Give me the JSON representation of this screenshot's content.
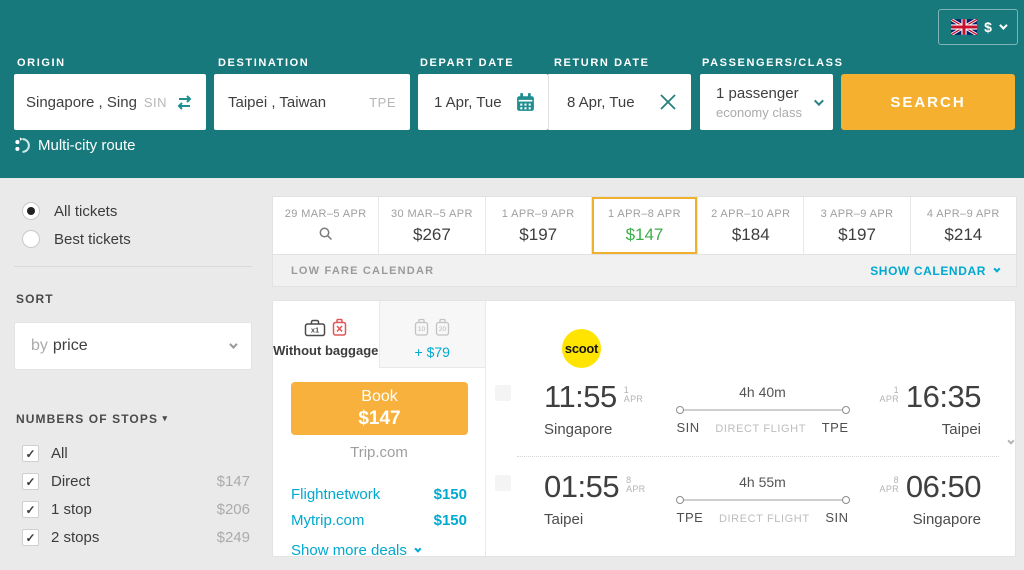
{
  "colors": {
    "teal": "#17797b",
    "amber": "#f4b02e",
    "cyan_link": "#00a9cf",
    "green_price": "#3cae4c",
    "scoot_yellow": "#ffe400",
    "page_bg": "#eaeaea"
  },
  "header": {
    "origin": {
      "label": "ORIGIN",
      "value": "Singapore , Sing",
      "code": "SIN"
    },
    "destination": {
      "label": "DESTINATION",
      "value": "Taipei , Taiwan",
      "code": "TPE"
    },
    "depart": {
      "label": "DEPART DATE",
      "value": "1 Apr, Tue"
    },
    "return": {
      "label": "RETURN DATE",
      "value": "8 Apr, Tue"
    },
    "passengers": {
      "label": "PASSENGERS/CLASS",
      "value": "1 passenger",
      "subvalue": "economy class"
    },
    "search_label": "SEARCH",
    "multicity_label": "Multi-city route",
    "currency": "$"
  },
  "sidebar": {
    "filters": [
      {
        "label": "All tickets"
      },
      {
        "label": "Best tickets"
      }
    ],
    "sort": {
      "heading": "SORT",
      "prefix": "by",
      "value": "price"
    },
    "stops": {
      "heading": "NUMBERS OF STOPS",
      "options": [
        {
          "label": "All",
          "price": ""
        },
        {
          "label": "Direct",
          "price": "$147"
        },
        {
          "label": "1 stop",
          "price": "$206"
        },
        {
          "label": "2 stops",
          "price": "$249"
        }
      ]
    }
  },
  "date_tabs": [
    {
      "range": "29 MAR–5 APR",
      "price": ""
    },
    {
      "range": "30 MAR–5 APR",
      "price": "$267"
    },
    {
      "range": "1 APR–9 APR",
      "price": "$197"
    },
    {
      "range": "1 APR–8 APR",
      "price": "$147"
    },
    {
      "range": "2 APR–10 APR",
      "price": "$184"
    },
    {
      "range": "3 APR–9 APR",
      "price": "$197"
    },
    {
      "range": "4 APR–9 APR",
      "price": "$214"
    }
  ],
  "calendar_bar": {
    "left": "LOW FARE CALENDAR",
    "right": "SHOW CALENDAR"
  },
  "ticket": {
    "baggage_tabs": [
      {
        "label": "Without baggage",
        "icon1_label": "x1"
      },
      {
        "label": "+ $79",
        "icon1_label": "10",
        "icon2_label": "20"
      }
    ],
    "book": {
      "line1": "Book",
      "line2": "$147"
    },
    "agency": "Trip.com",
    "deals": [
      {
        "name": "Flightnetwork",
        "price": "$150"
      },
      {
        "name": "Mytrip.com",
        "price": "$150"
      }
    ],
    "more_deals": "Show more deals",
    "airline": "scoot",
    "legs": [
      {
        "dep_time": "11:55",
        "dep_day": "1",
        "dep_mon": "APR",
        "dep_city": "Singapore",
        "duration": "4h 40m",
        "dep_code": "SIN",
        "note": "DIRECT FLIGHT",
        "arr_code": "TPE",
        "arr_time": "16:35",
        "arr_day": "1",
        "arr_mon": "APR",
        "arr_city": "Taipei"
      },
      {
        "dep_time": "01:55",
        "dep_day": "8",
        "dep_mon": "APR",
        "dep_city": "Taipei",
        "duration": "4h 55m",
        "dep_code": "TPE",
        "note": "DIRECT FLIGHT",
        "arr_code": "SIN",
        "arr_time": "06:50",
        "arr_day": "8",
        "arr_mon": "APR",
        "arr_city": "Singapore"
      }
    ]
  }
}
